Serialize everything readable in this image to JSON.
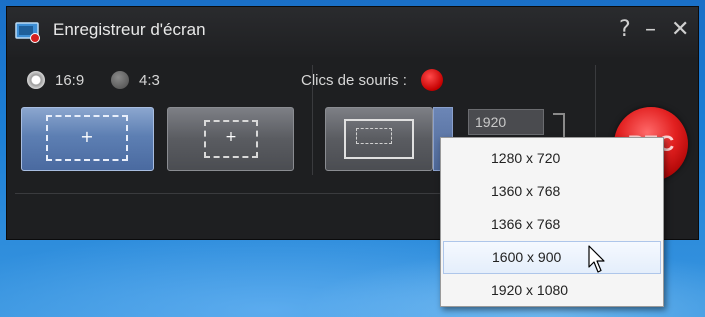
{
  "window": {
    "title": "Enregistreur d'écran",
    "help": "?",
    "minimize": "–",
    "close": "✕"
  },
  "aspect": {
    "options": [
      {
        "label": "16:9",
        "selected": true
      },
      {
        "label": "4:3",
        "selected": false
      }
    ]
  },
  "mouse_clicks": {
    "label": "Clics de souris :",
    "color": "#d40000"
  },
  "modes": {
    "full_plus": "+",
    "region_plus": "+",
    "dropdown_chevron": "⌄"
  },
  "size": {
    "width_value": "1920"
  },
  "record": {
    "label": "REC",
    "color": "#e22020"
  },
  "resolution_menu": {
    "items": [
      "1280 x 720",
      "1360 x 768",
      "1366 x 768",
      "1600 x 900",
      "1920 x 1080"
    ],
    "hovered": "1600 x 900"
  },
  "colors": {
    "window_bg": "#1e1f21",
    "accent_blue": "#5d7fb3",
    "desktop_blue": "#1c7fd6"
  },
  "icons": [
    "app-recorder-icon",
    "help-icon",
    "minimize-icon",
    "close-icon",
    "fullscreen-capture-icon",
    "region-capture-icon",
    "window-capture-icon",
    "chevron-down-icon",
    "link-bracket-icon",
    "mouse-pointer-icon"
  ]
}
